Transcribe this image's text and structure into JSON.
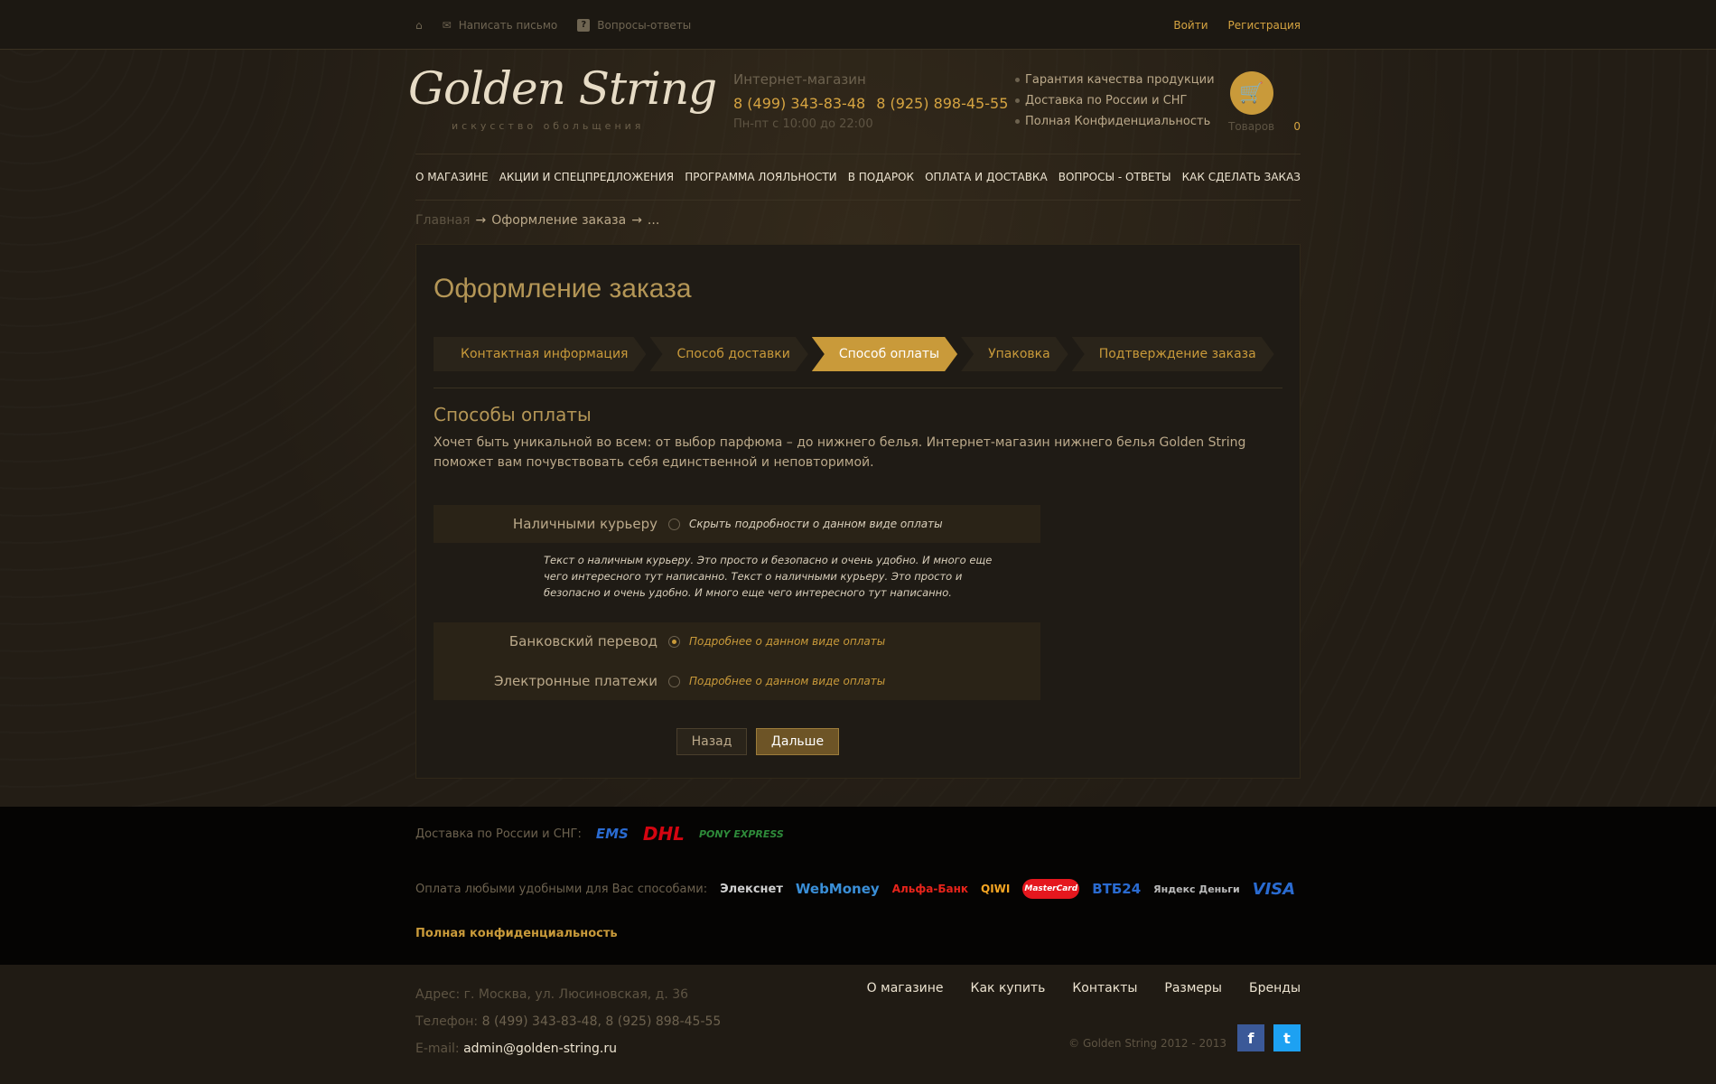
{
  "topbar": {
    "write_letter": "Написать письмо",
    "faq": "Вопросы-ответы",
    "login": "Войти",
    "register": "Регистрация"
  },
  "header": {
    "logo_text": "Golden String",
    "logo_sub": "искусство обольщения",
    "shop_title": "Интернет-магазин",
    "phone1": "8 (499) 343-83-48",
    "phone2": "8 (925) 898-45-55",
    "hours": "Пн-пт с 10:00 до 22:00",
    "bullets": [
      "Гарантия качества продукции",
      "Доставка по России и СНГ",
      "Полная Конфиденциальность"
    ],
    "cart_label": "Товаров",
    "cart_count": "0"
  },
  "nav": [
    "О магазине",
    "Акции и спецпредложения",
    "Программа лояльности",
    "В подарок",
    "Оплата и доставка",
    "Вопросы - ответы",
    "Как сделать заказ"
  ],
  "breadcrumb": {
    "home": "Главная",
    "current": "Оформление заказа",
    "sep": "→",
    "tail": "..."
  },
  "main": {
    "title": "Оформление заказа",
    "steps": [
      "Контактная информация",
      "Способ доставки",
      "Способ оплаты",
      "Упаковка",
      "Подтверждение заказа"
    ],
    "active_step": "Способ оплаты",
    "section_title": "Способы оплаты",
    "section_desc": "Хочет быть уникальной во всем: от выбор парфюма – до нижнего белья. Интернет-магазин нижнего белья Golden String поможет вам почувствовать себя единственной и неповторимой.",
    "payments": [
      {
        "label": "Наличными курьеру",
        "link": "Скрыть подробности о данном виде оплаты",
        "selected": false
      },
      {
        "label": "Банковский перевод",
        "link": "Подробнее о данном виде оплаты",
        "selected": true
      },
      {
        "label": "Электронные платежи",
        "link": "Подробнее о данном виде оплаты",
        "selected": false
      }
    ],
    "courier_text": "Текст о наличным курьеру. Это просто и безопасно и очень удобно. И много еще чего интересного тут написанно. Текст о наличными курьеру. Это просто и безопасно и очень удобно. И много еще чего интересного тут написанно.",
    "back_label": "Назад",
    "next_label": "Дальше"
  },
  "footer": {
    "delivery_label": "Доставка по России и СНГ:",
    "delivery_logos": [
      "EMS",
      "DHL",
      "PONY EXPRESS"
    ],
    "payment_label": "Оплата любыми удобными для Вас способами:",
    "payment_logos": [
      "Элекснет",
      "WebMoney",
      "Альфа-Банк",
      "QIWI",
      "MasterCard",
      "ВТБ24",
      "Яндекс Деньги",
      "VISA"
    ],
    "confidential": "Полная конфиденциальность",
    "address": "Адрес: г. Москва, ул. Люсиновская, д. 36",
    "phone_label": "Телефон:",
    "phones": "8 (499) 343-83-48, 8 (925) 898-45-55",
    "email_label": "E-mail:",
    "email": "admin@golden-string.ru",
    "links": [
      "О магазине",
      "Как купить",
      "Контакты",
      "Размеры",
      "Бренды"
    ],
    "copyright": "© Golden String  2012 - 2013"
  },
  "colors": {
    "accent": "#c99a3a",
    "background": "#231d15",
    "footer_dark": "#050403"
  }
}
